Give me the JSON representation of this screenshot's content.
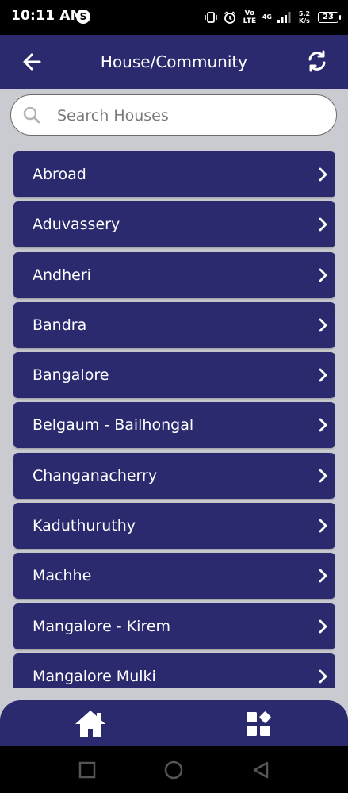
{
  "status_bar": {
    "time": "10:11 AM",
    "app_badge": "S",
    "volte": "Vo LTE",
    "network": "4G",
    "speed": "5.2 K/s",
    "battery": "23"
  },
  "header": {
    "title": "House/Community"
  },
  "search": {
    "placeholder": "Search Houses",
    "value": ""
  },
  "houses": [
    "Abroad",
    "Aduvassery",
    "Andheri",
    "Bandra",
    "Bangalore",
    "Belgaum - Bailhongal",
    "Changanacherry",
    "Kaduthuruthy",
    "Machhe",
    "Mangalore - Kirem",
    "Mangalore Mulki"
  ],
  "icons": {
    "back": "arrow-left-icon",
    "refresh": "refresh-icon",
    "search": "search-icon",
    "item_chevron": "chevron-right-icon",
    "nav_home": "home-icon",
    "nav_dashboard": "grid-icon"
  },
  "colors": {
    "primary": "#2b2a6f",
    "background": "#c9cbd1",
    "text_on_primary": "#ffffff"
  }
}
